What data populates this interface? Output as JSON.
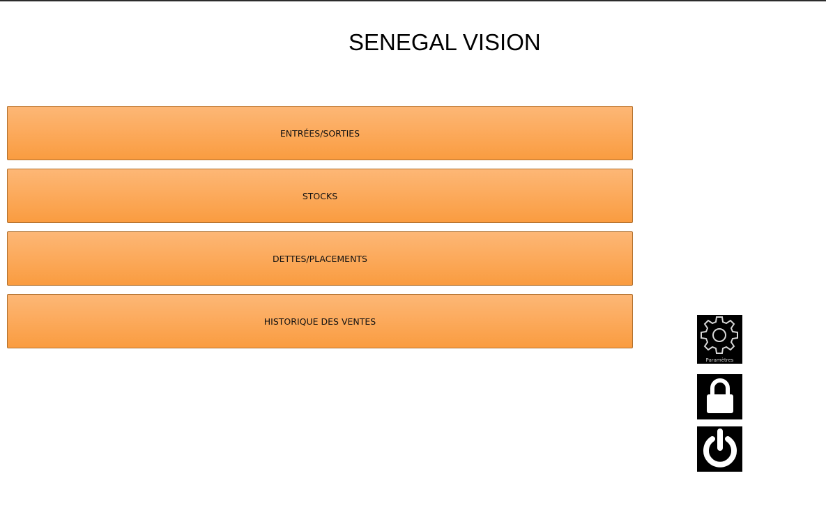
{
  "app": {
    "title": "SENEGAL VISION"
  },
  "menu": {
    "items": [
      {
        "label": "ENTRÉES/SORTIES"
      },
      {
        "label": "STOCKS"
      },
      {
        "label": "DETTES/PLACEMENTS"
      },
      {
        "label": "HISTORIQUE DES VENTES"
      }
    ]
  },
  "side_actions": {
    "settings": {
      "label": "Paramètres",
      "icon": "gear-icon"
    },
    "lock": {
      "icon": "lock-icon"
    },
    "power": {
      "icon": "power-icon"
    }
  },
  "colors": {
    "button_top": "#fdb776",
    "button_bottom": "#fa9c40",
    "button_border": "#b0702e",
    "icon_background": "#000000"
  }
}
